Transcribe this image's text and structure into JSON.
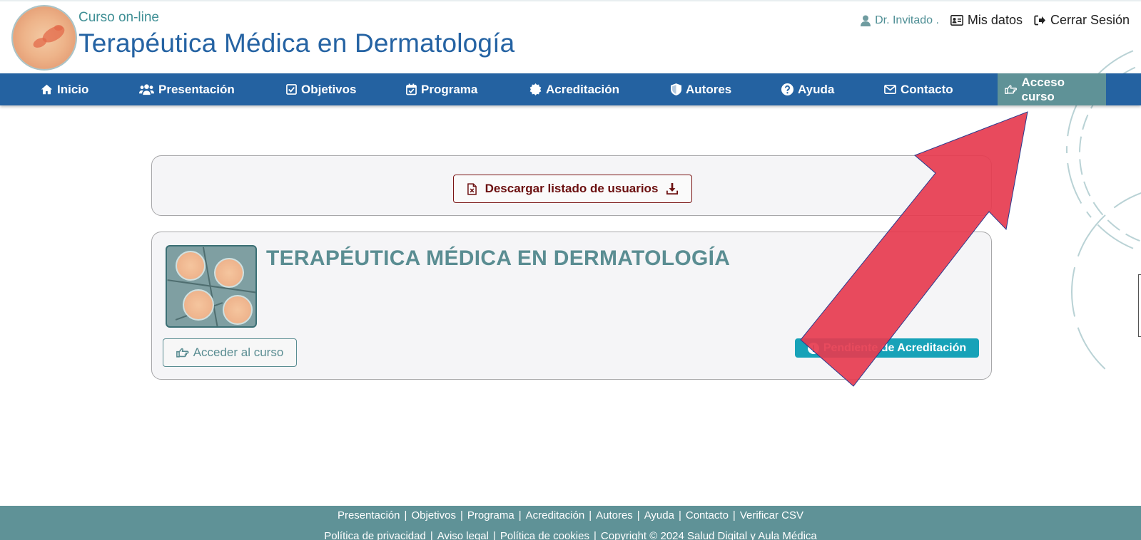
{
  "header": {
    "subtitle": "Curso on-line",
    "title": "Terapéutica Médica en Dermatología",
    "user_name": "Dr. Invitado .",
    "my_data_label": "Mis datos",
    "logout_label": "Cerrar Sesión"
  },
  "nav": {
    "items": [
      {
        "label": "Inicio",
        "icon": "home-icon"
      },
      {
        "label": "Presentación",
        "icon": "users-icon"
      },
      {
        "label": "Objetivos",
        "icon": "check-square-icon"
      },
      {
        "label": "Programa",
        "icon": "calendar-check-icon"
      },
      {
        "label": "Acreditación",
        "icon": "certificate-icon"
      },
      {
        "label": "Autores",
        "icon": "shield-icon"
      },
      {
        "label": "Ayuda",
        "icon": "question-circle-icon"
      },
      {
        "label": "Contacto",
        "icon": "envelope-icon"
      },
      {
        "label": "Acceso curso",
        "icon": "hand-point-right-icon",
        "active": true
      }
    ]
  },
  "main": {
    "download_label": "Descargar listado de usuarios",
    "course_title": "TERAPÉUTICA MÉDICA EN DERMATOLOGÍA",
    "access_label": "Acceder al curso",
    "status_badge": "Pendiente de Acreditación"
  },
  "colors": {
    "nav_bg": "#2462a1",
    "nav_active": "#5f9297",
    "title_blue": "#2563a3",
    "teal": "#5a8d92",
    "badge": "#17a2b8",
    "download_red": "#6b0f0f",
    "arrow_red": "#e63b4f",
    "footer_bg": "#5f9297"
  },
  "footer": {
    "links": [
      "Presentación",
      "Objetivos",
      "Programa",
      "Acreditación",
      "Autores",
      "Ayuda",
      "Contacto",
      "Verificar CSV"
    ],
    "legal": [
      "Política de privacidad",
      "Aviso legal",
      "Política de cookies",
      "Copyright © 2024 Salud Digital y Aula Médica"
    ]
  }
}
